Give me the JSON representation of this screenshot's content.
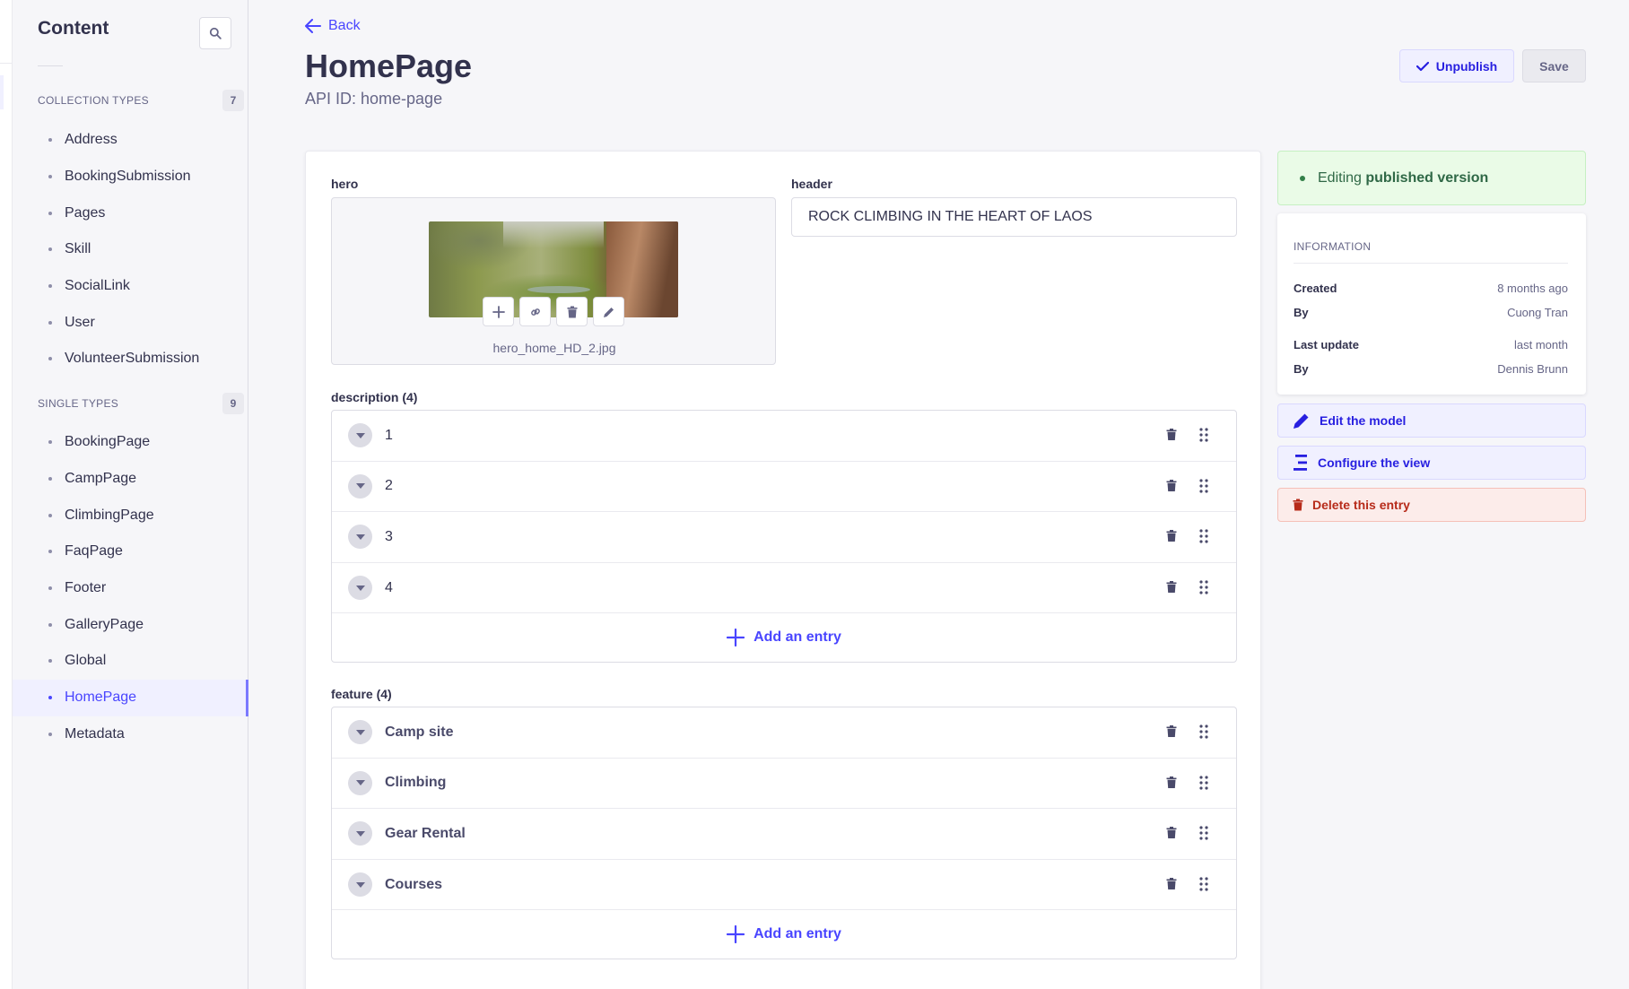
{
  "sidebar": {
    "title": "Content",
    "collection_types": {
      "label": "COLLECTION TYPES",
      "count": "7",
      "items": [
        "Address",
        "BookingSubmission",
        "Pages",
        "Skill",
        "SocialLink",
        "User",
        "VolunteerSubmission"
      ]
    },
    "single_types": {
      "label": "SINGLE TYPES",
      "count": "9",
      "items": [
        "BookingPage",
        "CampPage",
        "ClimbingPage",
        "FaqPage",
        "Footer",
        "GalleryPage",
        "Global",
        "HomePage",
        "Metadata"
      ],
      "active": "HomePage"
    }
  },
  "header": {
    "back_label": "Back",
    "title": "HomePage",
    "api_id": "API ID: home-page",
    "unpublish_label": "Unpublish",
    "save_label": "Save"
  },
  "form": {
    "hero": {
      "label": "hero",
      "filename": "hero_home_HD_2.jpg"
    },
    "header_field": {
      "label": "header",
      "value": "ROCK CLIMBING IN THE HEART OF LAOS"
    },
    "description": {
      "label": "description (4)",
      "entries": [
        "1",
        "2",
        "3",
        "4"
      ],
      "add_label": "Add an entry"
    },
    "feature": {
      "label": "feature (4)",
      "entries": [
        "Camp site",
        "Climbing",
        "Gear Rental",
        "Courses"
      ],
      "add_label": "Add an entry"
    }
  },
  "panel": {
    "status_prefix": "Editing",
    "status_bold": "published version",
    "info_title": "INFORMATION",
    "created_label": "Created",
    "created_value": "8 months ago",
    "created_by_label": "By",
    "created_by_value": "Cuong Tran",
    "updated_label": "Last update",
    "updated_value": "last month",
    "updated_by_label": "By",
    "updated_by_value": "Dennis Brunn",
    "edit_model_label": "Edit the model",
    "configure_view_label": "Configure the view",
    "delete_label": "Delete this entry"
  },
  "colors": {
    "primary": "#4945ff",
    "danger": "#b72b1a",
    "success": "#328048"
  }
}
